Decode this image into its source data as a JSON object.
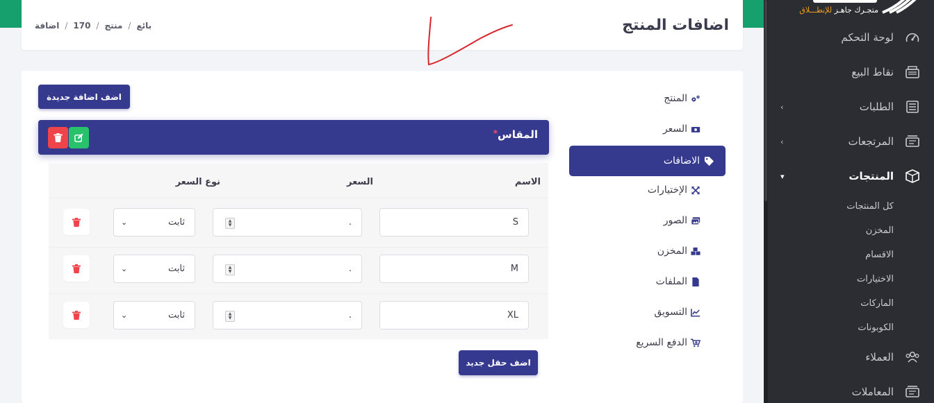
{
  "sidebar": {
    "logo_tagline_part1": "متجـرك جاهـز ",
    "logo_tagline_part2": "للإنطـــلاق",
    "items": [
      {
        "label": "لوحة التحكم",
        "icon": "speedometer-icon"
      },
      {
        "label": "نقاط البيع",
        "icon": "cash-register-icon"
      },
      {
        "label": "الطلبات",
        "icon": "list-icon"
      },
      {
        "label": "المرتجعات",
        "icon": "return-icon"
      },
      {
        "label": "المنتجات",
        "icon": "box-icon"
      },
      {
        "label": "العملاء",
        "icon": "users-icon"
      },
      {
        "label": "المعاملات",
        "icon": "transactions-icon"
      }
    ],
    "sub_items": [
      "كل المنتجات",
      "المخزن",
      "الاقسام",
      "الاختيارات",
      "الماركات",
      "الكوبونات"
    ]
  },
  "header": {
    "title": "اضافات المنتج",
    "breadcrumb": [
      "بائع",
      "منتج",
      "170",
      "اضافة"
    ]
  },
  "product_menu": [
    {
      "label": "المنتج",
      "icon": "gears-icon"
    },
    {
      "label": "السعر",
      "icon": "money-bill-icon"
    },
    {
      "label": "الاضافات",
      "icon": "tags-icon"
    },
    {
      "label": "الإختيارات",
      "icon": "expand-arrows-icon"
    },
    {
      "label": "الصور",
      "icon": "images-icon"
    },
    {
      "label": "المخزن",
      "icon": "cubes-icon"
    },
    {
      "label": "الملفات",
      "icon": "file-icon"
    },
    {
      "label": "التسويق",
      "icon": "chart-line-icon"
    },
    {
      "label": "الدفع السريع",
      "icon": "cart-plus-icon"
    }
  ],
  "buttons": {
    "add_new_addition": "اضف اضافة جديدة",
    "add_new_field": "اضف حقل جديد"
  },
  "addon_group": {
    "title": "المقاس",
    "required_mark": "*"
  },
  "table": {
    "headers": {
      "name": "الاسم",
      "price": "السعر",
      "price_type": "نوع السعر"
    },
    "rows": [
      {
        "name": "S",
        "price": ".",
        "price_type": "ثابت"
      },
      {
        "name": "M",
        "price": ".",
        "price_type": "ثابت"
      },
      {
        "name": "XL",
        "price": ".",
        "price_type": "ثابت"
      }
    ]
  },
  "colors": {
    "primary": "#363a8e",
    "sidebar_bg": "#2b2d32",
    "top_bar": "#16a06e",
    "delete": "#f0444b",
    "edit": "#27c26b",
    "scribble": "#d9262d"
  }
}
